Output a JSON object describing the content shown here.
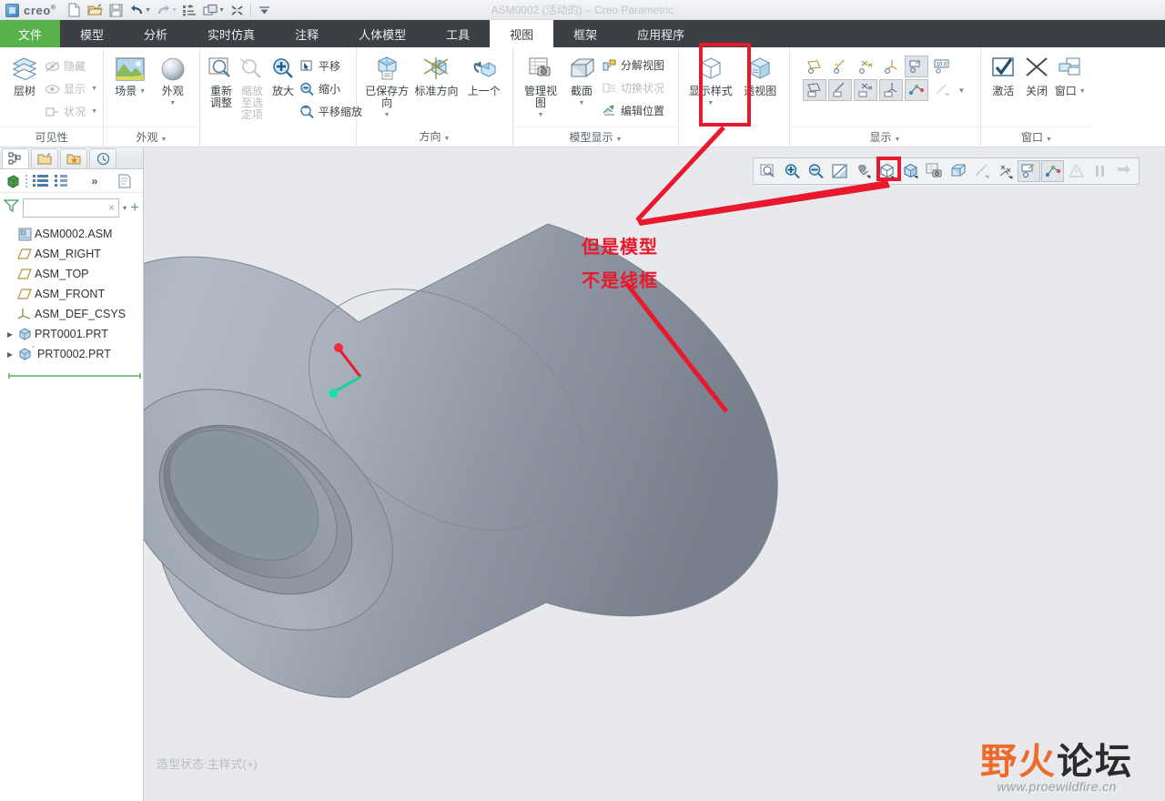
{
  "window": {
    "title": "ASM0002 (活动的) – Creo Parametric",
    "brand": "creo",
    "brand_sup": "®"
  },
  "quick_access": [
    {
      "name": "new-file-icon",
      "label": "新建"
    },
    {
      "name": "open-file-icon",
      "label": "打开"
    },
    {
      "name": "save-icon",
      "label": "保存"
    },
    {
      "name": "undo-icon",
      "label": "撤消"
    },
    {
      "name": "undo-dropdown-icon",
      "label": "撤消下拉"
    },
    {
      "name": "redo-icon",
      "label": "重做"
    },
    {
      "name": "redo-dropdown-icon",
      "label": "重做下拉"
    },
    {
      "name": "regenerate-icon",
      "label": "重新生成"
    },
    {
      "name": "window-switch-icon",
      "label": "切换窗口"
    },
    {
      "name": "window-switch-dropdown-icon",
      "label": "切换窗口下拉"
    },
    {
      "name": "close-window-icon",
      "label": "关闭窗口"
    },
    {
      "name": "customize-qat-icon",
      "label": "自定义快速访问工具栏"
    }
  ],
  "ribbon_tabs": [
    {
      "label": "文件",
      "kind": "file"
    },
    {
      "label": "模型",
      "kind": "normal"
    },
    {
      "label": "分析",
      "kind": "normal"
    },
    {
      "label": "实时仿真",
      "kind": "normal"
    },
    {
      "label": "注释",
      "kind": "normal"
    },
    {
      "label": "人体模型",
      "kind": "normal"
    },
    {
      "label": "工具",
      "kind": "normal"
    },
    {
      "label": "视图",
      "kind": "active"
    },
    {
      "label": "框架",
      "kind": "normal"
    },
    {
      "label": "应用程序",
      "kind": "normal"
    }
  ],
  "ribbon_groups": [
    {
      "title": "可见性",
      "has_caret": false,
      "big": [
        {
          "label": "层树",
          "icon": "layers-icon",
          "caret": false,
          "dim": false
        }
      ],
      "small": [
        {
          "label": "隐藏",
          "icon": "hide-icon",
          "caret": false,
          "dim": true
        },
        {
          "label": "显示",
          "icon": "eye-icon",
          "caret": true,
          "dim": true
        },
        {
          "label": "状况",
          "icon": "status-icon",
          "caret": true,
          "dim": true
        }
      ]
    },
    {
      "title": "外观",
      "has_caret": true,
      "big": [
        {
          "label": "场景",
          "icon": "scene-icon",
          "caret": true,
          "dim": false
        },
        {
          "label": "外观",
          "icon": "appearance-sphere-icon",
          "caret": true,
          "dim": false
        }
      ],
      "small": []
    },
    {
      "title": "方向",
      "has_caret": true,
      "big": [
        {
          "label": "重新调整",
          "icon": "refit-icon",
          "caret": false,
          "dim": false
        },
        {
          "label": "缩放至选定项",
          "icon": "zoom-to-selection-icon",
          "caret": false,
          "dim": true
        },
        {
          "label": "放大",
          "icon": "zoom-in-icon",
          "caret": false,
          "dim": false
        }
      ],
      "small": [
        {
          "label": "平移",
          "icon": "pan-icon",
          "caret": false,
          "dim": false
        },
        {
          "label": "缩小",
          "icon": "zoom-out-icon",
          "caret": false,
          "dim": false
        },
        {
          "label": "平移缩放",
          "icon": "pan-zoom-icon",
          "caret": false,
          "dim": false
        }
      ]
    },
    {
      "title": "",
      "has_caret": false,
      "big": [
        {
          "label": "已保存方向",
          "icon": "saved-orientation-icon",
          "caret": true,
          "dim": false
        },
        {
          "label": "标准方向",
          "icon": "standard-orientation-icon",
          "caret": false,
          "dim": false
        },
        {
          "label": "上一个",
          "icon": "previous-view-icon",
          "caret": false,
          "dim": false
        }
      ],
      "small": []
    },
    {
      "title": "模型显示",
      "has_caret": true,
      "big": [
        {
          "label": "管理视图",
          "icon": "manage-views-icon",
          "caret": true,
          "dim": false
        },
        {
          "label": "截面",
          "icon": "section-icon",
          "caret": true,
          "dim": false
        }
      ],
      "small": [
        {
          "label": "分解视图",
          "icon": "exploded-view-icon",
          "caret": false,
          "dim": false
        },
        {
          "label": "切换状况",
          "icon": "toggle-status-icon",
          "caret": false,
          "dim": true
        },
        {
          "label": "编辑位置",
          "icon": "edit-position-icon",
          "caret": false,
          "dim": false
        }
      ]
    },
    {
      "title": "",
      "has_caret": false,
      "big": [
        {
          "label": "显示样式",
          "icon": "display-style-cube-icon",
          "caret": true,
          "dim": false
        },
        {
          "label": "透视图",
          "icon": "perspective-view-icon",
          "caret": false,
          "dim": false
        }
      ],
      "small": []
    },
    {
      "title": "显示",
      "has_caret": true,
      "big": [],
      "icon_grid": {
        "row1": [
          {
            "name": "plane-display-icon",
            "selected": false
          },
          {
            "name": "axis-display-icon",
            "selected": false
          },
          {
            "name": "point-display-icon",
            "selected": false
          },
          {
            "name": "csys-display-icon",
            "selected": false
          },
          {
            "name": "annotation-display-icon",
            "selected": true
          },
          {
            "name": "dimension-display-icon",
            "selected": false
          }
        ],
        "row2": [
          {
            "name": "plane-tag-display-icon",
            "selected": true
          },
          {
            "name": "axis-tag-display-icon",
            "selected": true
          },
          {
            "name": "point-tag-display-icon",
            "selected": true
          },
          {
            "name": "csys-tag-display-icon",
            "selected": true
          },
          {
            "name": "spin-center-icon",
            "selected": true
          },
          {
            "name": "edge-display-icon",
            "selected": false
          },
          {
            "name": "display-more-dropdown-icon",
            "selected": false
          }
        ]
      }
    },
    {
      "title": "窗口",
      "has_caret": true,
      "big": [
        {
          "label": "激活",
          "icon": "activate-check-icon",
          "caret": false,
          "dim": false
        },
        {
          "label": "关闭",
          "icon": "close-x-icon",
          "caret": false,
          "dim": false
        },
        {
          "label": "窗口",
          "icon": "windows-cascade-icon",
          "caret": true,
          "dim": false
        }
      ],
      "small": []
    }
  ],
  "left_panel": {
    "tabs": [
      {
        "name": "model-tree-tab",
        "active": true
      },
      {
        "name": "folder-browser-tab",
        "active": false
      },
      {
        "name": "favorites-tab",
        "active": false
      },
      {
        "name": "history-tab",
        "active": false
      }
    ],
    "toolbar": [
      {
        "name": "show-icon",
        "label": "显示"
      },
      {
        "name": "settings-list-icon",
        "label": "设置"
      },
      {
        "name": "tree-columns-icon",
        "label": "树列"
      },
      {
        "name": "more-chevrons-icon",
        "label": "更多"
      },
      {
        "name": "tree-filters-icon",
        "label": "树过滤器"
      }
    ],
    "filter": {
      "icon": "filter-funnel-icon",
      "value": "",
      "placeholder": "",
      "clear_label": "×",
      "dropdown_label": "▾",
      "add_label": "+"
    },
    "tree": [
      {
        "label": "ASM0002.ASM",
        "icon": "assembly-icon",
        "indent": 0,
        "arrow": false
      },
      {
        "label": "ASM_RIGHT",
        "icon": "datum-plane-icon",
        "indent": 1,
        "arrow": false
      },
      {
        "label": "ASM_TOP",
        "icon": "datum-plane-icon",
        "indent": 1,
        "arrow": false
      },
      {
        "label": "ASM_FRONT",
        "icon": "datum-plane-icon",
        "indent": 1,
        "arrow": false
      },
      {
        "label": "ASM_DEF_CSYS",
        "icon": "datum-csys-icon",
        "indent": 1,
        "arrow": false
      },
      {
        "label": "PRT0001.PRT",
        "icon": "part-icon",
        "indent": 1,
        "arrow": true
      },
      {
        "label": "PRT0002.PRT",
        "icon": "part-icon",
        "indent": 1,
        "arrow": true
      }
    ]
  },
  "graphics_toolbar": [
    {
      "name": "refit-icon",
      "selected": false,
      "dim": false
    },
    {
      "name": "zoom-in-icon",
      "selected": false,
      "dim": false
    },
    {
      "name": "zoom-out-icon",
      "selected": false,
      "dim": false
    },
    {
      "name": "repaint-icon",
      "selected": false,
      "dim": false
    },
    {
      "name": "saved-orientations-icon",
      "selected": false,
      "dim": false
    },
    {
      "name": "display-style-icon",
      "selected": false,
      "dim": false
    },
    {
      "name": "perspective-icon",
      "selected": false,
      "dim": false
    },
    {
      "name": "manage-views-icon",
      "selected": false,
      "dim": false
    },
    {
      "name": "section-icon",
      "selected": false,
      "dim": false
    },
    {
      "name": "edge-display-icon",
      "selected": false,
      "dim": true
    },
    {
      "name": "datum-display-filters-icon",
      "selected": false,
      "dim": false
    },
    {
      "name": "annotation-display-icon",
      "selected": true,
      "dim": false
    },
    {
      "name": "spin-center-icon",
      "selected": true,
      "dim": false
    },
    {
      "name": "warning-icon",
      "selected": false,
      "dim": true
    },
    {
      "name": "pause-icon",
      "selected": false,
      "dim": true
    },
    {
      "name": "stop-icon",
      "selected": false,
      "dim": true
    }
  ],
  "viewport": {
    "status_text": "造型状态:主样式(+)",
    "background_color": "#e8e9ec",
    "model_color": "#8d96a3",
    "csys": {
      "x_axis_color": "#e8192c",
      "z_axis_color": "#17d39b"
    }
  },
  "annotations": {
    "line1": "但是模型",
    "line2": "不是线框",
    "color": "#e8192c"
  },
  "watermark": {
    "char1": "野",
    "char2": "火",
    "char3": "论",
    "char4": "坛",
    "url": "www.proewildfire.cn",
    "accent_color": "#ee6b2d"
  }
}
